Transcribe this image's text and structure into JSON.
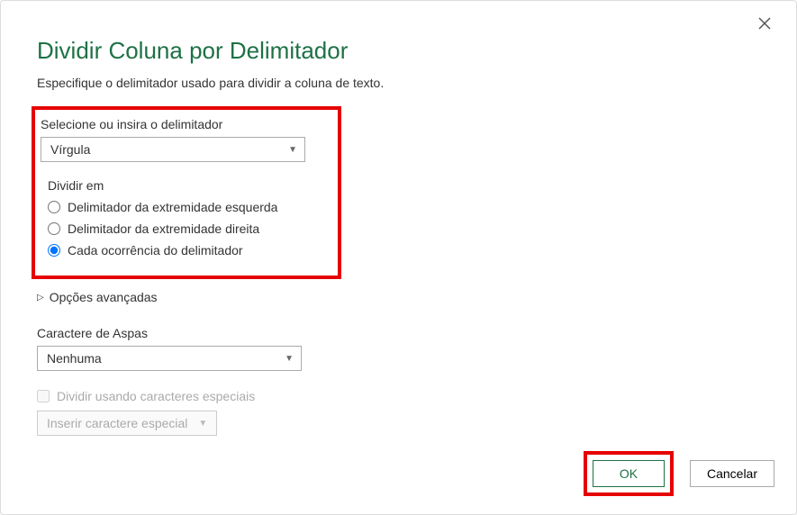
{
  "dialog": {
    "title": "Dividir Coluna por Delimitador",
    "subtitle": "Especifique o delimitador usado para dividir a coluna de texto."
  },
  "delimiter": {
    "label": "Selecione ou insira o delimitador",
    "selected": "Vírgula"
  },
  "split_at": {
    "heading": "Dividir em",
    "options": [
      {
        "label": "Delimitador da extremidade esquerda",
        "checked": false
      },
      {
        "label": "Delimitador da extremidade direita",
        "checked": false
      },
      {
        "label": "Cada ocorrência do delimitador",
        "checked": true
      }
    ]
  },
  "advanced": {
    "label": "Opções avançadas"
  },
  "quote": {
    "label": "Caractere de Aspas",
    "selected": "Nenhuma"
  },
  "special": {
    "checkbox_label": "Dividir usando caracteres especiais",
    "button_label": "Inserir caractere especial"
  },
  "footer": {
    "ok": "OK",
    "cancel": "Cancelar"
  }
}
